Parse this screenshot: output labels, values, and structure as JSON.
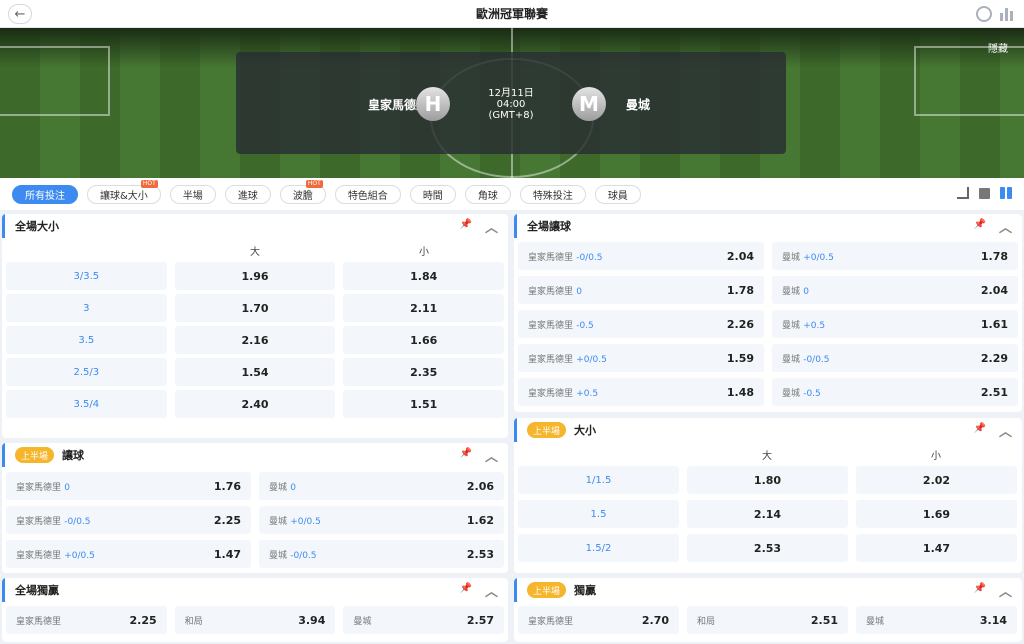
{
  "top": {
    "title": "歐洲冠軍聯賽",
    "back": "←"
  },
  "match": {
    "home": {
      "name": "皇家馬德里",
      "badge": "H"
    },
    "away": {
      "name": "曼城",
      "badge": "M"
    },
    "date": "12月11日",
    "time": "04:00",
    "tz": "(GMT+8)",
    "hide": "隱藏"
  },
  "tabs": [
    {
      "label": "所有投注",
      "active": true
    },
    {
      "label": "讓球&大小",
      "hot": "HOT"
    },
    {
      "label": "半場"
    },
    {
      "label": "進球"
    },
    {
      "label": "波膽",
      "hot": "HOT"
    },
    {
      "label": "特色組合"
    },
    {
      "label": "時間"
    },
    {
      "label": "角球"
    },
    {
      "label": "特殊投注"
    },
    {
      "label": "球員"
    }
  ],
  "panels": {
    "ft_ou": {
      "title": "全場大小",
      "over": "大",
      "under": "小",
      "rows": [
        {
          "line": "3/3.5",
          "over": "1.96",
          "under": "1.84"
        },
        {
          "line": "3",
          "over": "1.70",
          "under": "2.11"
        },
        {
          "line": "3.5",
          "over": "2.16",
          "under": "1.66"
        },
        {
          "line": "2.5/3",
          "over": "1.54",
          "under": "2.35"
        },
        {
          "line": "3.5/4",
          "over": "2.40",
          "under": "1.51"
        }
      ]
    },
    "ft_hdp": {
      "title": "全場讓球",
      "rows": [
        {
          "home": "皇家馬德里",
          "home_hdp": "-0/0.5",
          "home_odds": "2.04",
          "away": "曼城",
          "away_hdp": "+0/0.5",
          "away_odds": "1.78"
        },
        {
          "home": "皇家馬德里",
          "home_hdp": "0",
          "home_odds": "1.78",
          "away": "曼城",
          "away_hdp": "0",
          "away_odds": "2.04"
        },
        {
          "home": "皇家馬德里",
          "home_hdp": "-0.5",
          "home_odds": "2.26",
          "away": "曼城",
          "away_hdp": "+0.5",
          "away_odds": "1.61"
        },
        {
          "home": "皇家馬德里",
          "home_hdp": "+0/0.5",
          "home_odds": "1.59",
          "away": "曼城",
          "away_hdp": "-0/0.5",
          "away_odds": "2.29"
        },
        {
          "home": "皇家馬德里",
          "home_hdp": "+0.5",
          "home_odds": "1.48",
          "away": "曼城",
          "away_hdp": "-0.5",
          "away_odds": "2.51"
        }
      ]
    },
    "ht_hdp": {
      "badge": "上半場",
      "title": "讓球",
      "rows": [
        {
          "home": "皇家馬德里",
          "home_hdp": "0",
          "home_odds": "1.76",
          "away": "曼城",
          "away_hdp": "0",
          "away_odds": "2.06"
        },
        {
          "home": "皇家馬德里",
          "home_hdp": "-0/0.5",
          "home_odds": "2.25",
          "away": "曼城",
          "away_hdp": "+0/0.5",
          "away_odds": "1.62"
        },
        {
          "home": "皇家馬德里",
          "home_hdp": "+0/0.5",
          "home_odds": "1.47",
          "away": "曼城",
          "away_hdp": "-0/0.5",
          "away_odds": "2.53"
        }
      ]
    },
    "ht_ou": {
      "badge": "上半場",
      "title": "大小",
      "over": "大",
      "under": "小",
      "rows": [
        {
          "line": "1/1.5",
          "over": "1.80",
          "under": "2.02"
        },
        {
          "line": "1.5",
          "over": "2.14",
          "under": "1.69"
        },
        {
          "line": "1.5/2",
          "over": "2.53",
          "under": "1.47"
        }
      ]
    },
    "ft_1x2": {
      "title": "全場獨贏",
      "items": [
        {
          "name": "皇家馬德里",
          "odds": "2.25"
        },
        {
          "name": "和局",
          "odds": "3.94"
        },
        {
          "name": "曼城",
          "odds": "2.57"
        }
      ]
    },
    "ht_1x2": {
      "badge": "上半場",
      "title": "獨贏",
      "items": [
        {
          "name": "皇家馬德里",
          "odds": "2.70"
        },
        {
          "name": "和局",
          "odds": "2.51"
        },
        {
          "name": "曼城",
          "odds": "3.14"
        }
      ]
    }
  },
  "icons": {
    "pin": "pin-icon",
    "collapse": "chevron-up-icon",
    "refresh": "refresh-icon",
    "stats": "bar-chart-icon"
  },
  "colors": {
    "accent": "#3d8bf0",
    "half_badge": "#f5b62c",
    "hot": "#f06a3b"
  }
}
